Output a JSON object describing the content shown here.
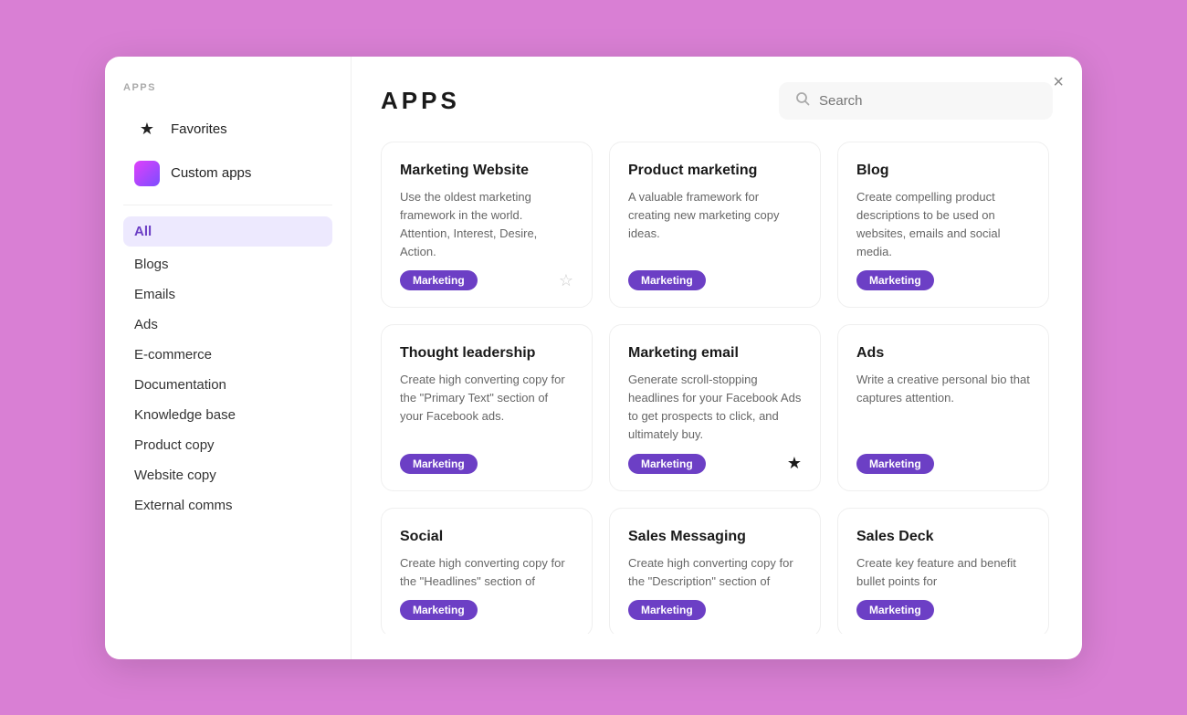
{
  "modal": {
    "close_label": "×"
  },
  "sidebar": {
    "section_label": "APPS",
    "top_items": [
      {
        "id": "favorites",
        "label": "Favorites",
        "icon": "★"
      },
      {
        "id": "custom-apps",
        "label": "Custom apps",
        "icon": "custom"
      }
    ],
    "categories": [
      {
        "id": "all",
        "label": "All",
        "active": true
      },
      {
        "id": "blogs",
        "label": "Blogs"
      },
      {
        "id": "emails",
        "label": "Emails"
      },
      {
        "id": "ads",
        "label": "Ads"
      },
      {
        "id": "ecommerce",
        "label": "E-commerce"
      },
      {
        "id": "documentation",
        "label": "Documentation"
      },
      {
        "id": "knowledge-base",
        "label": "Knowledge base"
      },
      {
        "id": "product-copy",
        "label": "Product copy"
      },
      {
        "id": "website-copy",
        "label": "Website copy"
      },
      {
        "id": "external-comms",
        "label": "External comms"
      }
    ]
  },
  "header": {
    "title": "APPS",
    "search_placeholder": "Search"
  },
  "cards": [
    {
      "id": "marketing-website",
      "title": "Marketing Website",
      "desc": "Use the oldest marketing framework in the world. Attention, Interest, Desire, Action.",
      "tag": "Marketing",
      "starred": false
    },
    {
      "id": "product-marketing",
      "title": "Product marketing",
      "desc": "A valuable framework for creating new marketing copy ideas.",
      "tag": "Marketing",
      "starred": false
    },
    {
      "id": "blog",
      "title": "Blog",
      "desc": "Create compelling product descriptions to be used on websites, emails and social media.",
      "tag": "Marketing",
      "starred": false
    },
    {
      "id": "thought-leadership",
      "title": "Thought leadership",
      "desc": "Create high converting copy for the \"Primary Text\" section of your Facebook ads.",
      "tag": "Marketing",
      "starred": false
    },
    {
      "id": "marketing-email",
      "title": "Marketing email",
      "desc": "Generate scroll-stopping headlines for your Facebook Ads to get prospects to click, and ultimately buy.",
      "tag": "Marketing",
      "starred": true
    },
    {
      "id": "ads",
      "title": "Ads",
      "desc": "Write a creative personal bio that captures attention.",
      "tag": "Marketing",
      "starred": false
    },
    {
      "id": "social",
      "title": "Social",
      "desc": "Create high converting copy for the \"Headlines\" section of",
      "tag": "Marketing",
      "starred": false
    },
    {
      "id": "sales-messaging",
      "title": "Sales Messaging",
      "desc": "Create high converting copy for the \"Description\" section of",
      "tag": "Marketing",
      "starred": false
    },
    {
      "id": "sales-deck",
      "title": "Sales Deck",
      "desc": "Create key feature and benefit bullet points for",
      "tag": "Marketing",
      "starred": false
    }
  ]
}
